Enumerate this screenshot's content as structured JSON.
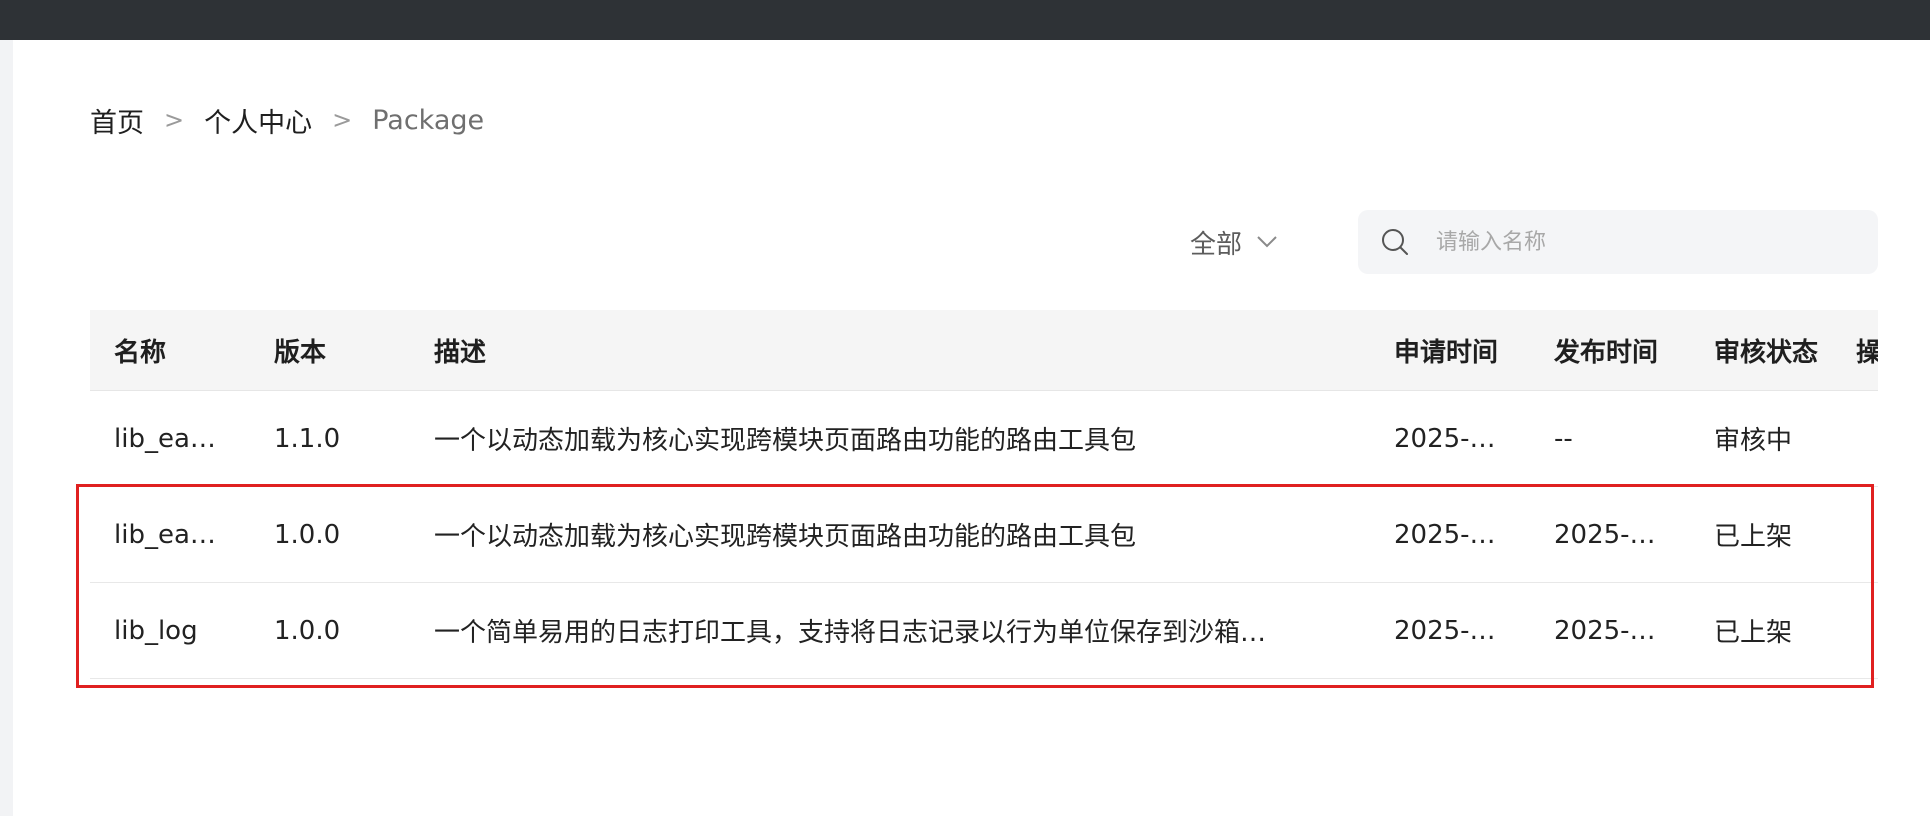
{
  "breadcrumb": {
    "home": "首页",
    "separator": ">",
    "personal": "个人中心",
    "current": "Package"
  },
  "filter": {
    "label": "全部"
  },
  "search": {
    "placeholder": "请输入名称",
    "value": ""
  },
  "table": {
    "headers": {
      "name": "名称",
      "version": "版本",
      "description": "描述",
      "apply_time": "申请时间",
      "publish_time": "发布时间",
      "status": "审核状态",
      "more": "操"
    },
    "rows": [
      {
        "name": "lib_ea…",
        "version": "1.1.0",
        "description": "一个以动态加载为核心实现跨模块页面路由功能的路由工具包",
        "apply_time": "2025-…",
        "publish_time": "--",
        "status": "审核中"
      },
      {
        "name": "lib_ea…",
        "version": "1.0.0",
        "description": "一个以动态加载为核心实现跨模块页面路由功能的路由工具包",
        "apply_time": "2025-…",
        "publish_time": "2025-…",
        "status": "已上架"
      },
      {
        "name": "lib_log",
        "version": "1.0.0",
        "description": "一个简单易用的日志打印工具，支持将日志记录以行为单位保存到沙箱…",
        "apply_time": "2025-…",
        "publish_time": "2025-…",
        "status": "已上架"
      }
    ]
  },
  "colors": {
    "topbar": "#2e3236",
    "highlight": "#e02020",
    "header_bg": "#f5f5f5",
    "search_bg": "#f4f5f7"
  }
}
